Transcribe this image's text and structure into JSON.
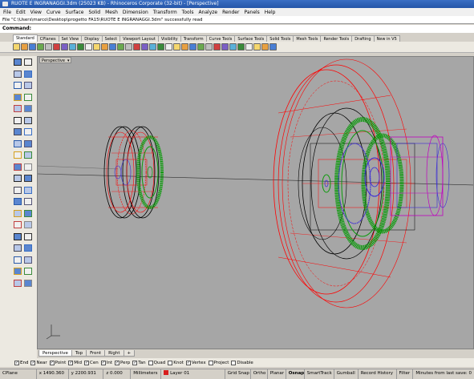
{
  "window": {
    "title": "RUOTE E INGRANAGGI.3dm (25023 KB) - Rhinoceros Corporate (32-bit) - [Perspective]"
  },
  "menu": [
    "File",
    "Edit",
    "View",
    "Curve",
    "Surface",
    "Solid",
    "Mesh",
    "Dimension",
    "Transform",
    "Tools",
    "Analyze",
    "Render",
    "Panels",
    "Help"
  ],
  "command": {
    "history": "File \"C:\\Users\\marco\\Desktop\\progetto FA15\\RUOTE E INGRANAGGI.3dm\" successfully read",
    "prompt": "Command:",
    "value": ""
  },
  "toolbar_tabs": [
    "Standard",
    "CPlanes",
    "Set View",
    "Display",
    "Select",
    "Viewport Layout",
    "Visibility",
    "Transform",
    "Curve Tools",
    "Surface Tools",
    "Solid Tools",
    "Mesh Tools",
    "Render Tools",
    "Drafting",
    "New in V5"
  ],
  "toolbar_icons": [
    "new-icon",
    "open-icon",
    "save-icon",
    "print-icon",
    "import-icon",
    "cut-icon",
    "copy-icon",
    "paste-icon",
    "undo-icon",
    "redo-icon",
    "pan-icon",
    "rotate-view-icon",
    "zoom-icon",
    "zoom-window-icon",
    "zoom-extents-icon",
    "zoom-selected-icon",
    "four-views-icon",
    "grid-icon",
    "snap-icon",
    "select-icon",
    "point-icon",
    "layer-icon",
    "properties-icon",
    "display-mode-icon",
    "wireframe-icon",
    "shaded-icon",
    "rendered-icon",
    "light-icon",
    "material-icon",
    "render-icon",
    "analyze-icon",
    "options-icon",
    "help-icon"
  ],
  "viewport": {
    "label": "Perspective",
    "tabs": [
      "Perspective",
      "Top",
      "Front",
      "Right"
    ],
    "add_tab": "+"
  },
  "osnaps": [
    {
      "label": "End",
      "checked": true
    },
    {
      "label": "Near",
      "checked": true
    },
    {
      "label": "Point",
      "checked": true
    },
    {
      "label": "Mid",
      "checked": true
    },
    {
      "label": "Cen",
      "checked": true
    },
    {
      "label": "Int",
      "checked": true
    },
    {
      "label": "Perp",
      "checked": true
    },
    {
      "label": "Tan",
      "checked": true
    },
    {
      "label": "Quad",
      "checked": false
    },
    {
      "label": "Knot",
      "checked": false
    },
    {
      "label": "Vertex",
      "checked": true
    },
    {
      "label": "Project",
      "checked": false
    },
    {
      "label": "Disable",
      "checked": false
    }
  ],
  "status": {
    "cplane": "CPlane",
    "x": "x 1490.360",
    "y": "y 2200.931",
    "z": "z 0.000",
    "units": "Millimeters",
    "layer": "Layer 01",
    "grid_snap": "Grid Snap",
    "ortho": "Ortho",
    "planar": "Planar",
    "osnap": "Osnap",
    "smarttrack": "SmartTrack",
    "gumball": "Gumball",
    "record_history": "Record History",
    "filter": "Filter",
    "autosave": "Minutes from last save: 0"
  },
  "colors": {
    "red_wire": "#ff0000",
    "green_gear": "#0a9a0a",
    "blue_gear": "#3a2ad8",
    "magenta": "#c000c0",
    "layer_swatch": "#d81e1e"
  }
}
